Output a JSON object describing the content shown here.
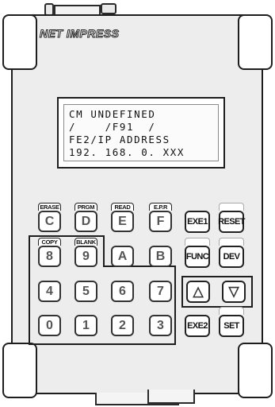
{
  "brand": {
    "logo_text": "NET IMPRESS"
  },
  "lcd": {
    "lines": [
      "CM UNDEFINED",
      "/    /F91  /",
      "FE2/IP ADDRESS",
      "192. 168. 0. XXX"
    ]
  },
  "keys": {
    "c": {
      "label": "C",
      "tab": "ERASE"
    },
    "d": {
      "label": "D",
      "tab": "PRGM"
    },
    "e": {
      "label": "E",
      "tab": "READ"
    },
    "f": {
      "label": "F",
      "tab": "E.P.R"
    },
    "exe": {
      "label": "EXE1"
    },
    "reset": {
      "label": "RESET"
    },
    "k8": {
      "label": "8",
      "tab": "COPY"
    },
    "k9": {
      "label": "9",
      "tab": "BLANK"
    },
    "a": {
      "label": "A"
    },
    "b": {
      "label": "B"
    },
    "func": {
      "label": "FUNC"
    },
    "dev": {
      "label": "DEV"
    },
    "k4": {
      "label": "4"
    },
    "k5": {
      "label": "5"
    },
    "k6": {
      "label": "6"
    },
    "k7": {
      "label": "7"
    },
    "up": {
      "label": "△"
    },
    "down": {
      "label": "▽"
    },
    "k0": {
      "label": "0"
    },
    "k1": {
      "label": "1"
    },
    "k2": {
      "label": "2"
    },
    "k3": {
      "label": "3"
    },
    "exe2": {
      "label": "EXE2"
    },
    "set": {
      "label": "SET"
    }
  }
}
